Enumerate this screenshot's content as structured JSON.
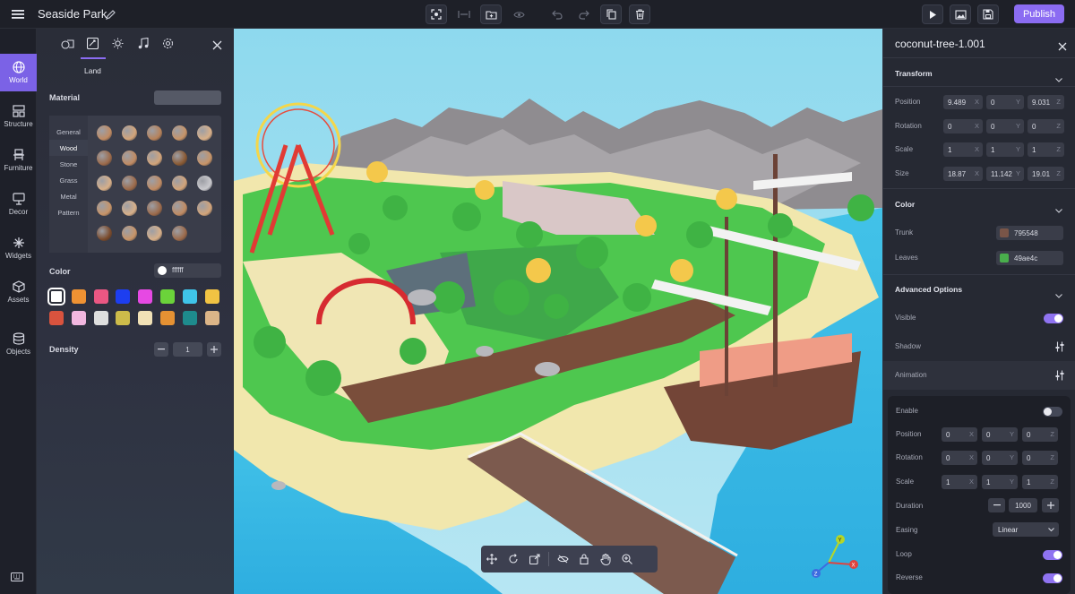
{
  "app": {
    "project_title": "Seaside Park",
    "publish_label": "Publish"
  },
  "toolbar": {
    "icons": [
      "menu-icon",
      "edit-icon",
      "focus-icon",
      "distribute-icon",
      "add-folder-icon",
      "eye-icon",
      "undo-icon",
      "redo-icon",
      "copy-icon",
      "delete-icon",
      "play-icon",
      "image-icon",
      "save-icon"
    ]
  },
  "leftnav": {
    "items": [
      {
        "label": "World",
        "icon": "globe-icon",
        "active": true
      },
      {
        "label": "Structure",
        "icon": "structure-icon"
      },
      {
        "label": "Furniture",
        "icon": "chair-icon"
      },
      {
        "label": "Decor",
        "icon": "decor-icon"
      },
      {
        "label": "Widgets",
        "icon": "widgets-icon"
      },
      {
        "label": "Assets",
        "icon": "cube-icon"
      },
      {
        "label": "Objects",
        "icon": "layers-icon"
      }
    ]
  },
  "leftpanel": {
    "active_tab": "Land",
    "material_label": "Material",
    "material_categories": [
      "General",
      "Wood",
      "Stone",
      "Grass",
      "Metal",
      "Pattern"
    ],
    "selected_category": "Wood",
    "color_label": "Color",
    "color_value": "ffffff",
    "density_label": "Density",
    "density_value": "1",
    "swatches": [
      "#ffffff",
      "#ef9233",
      "#ea5783",
      "#1d3ef0",
      "#e649e3",
      "#6bd33a",
      "#3fc4e9",
      "#f1c343",
      "#d9533e",
      "#f2b7e0",
      "#dedede",
      "#cdbb4a",
      "#f1e1b6",
      "#e59133",
      "#1e8b8d",
      "#dcb588"
    ]
  },
  "rightpanel": {
    "object_name": "coconut-tree-1.001",
    "transform_label": "Transform",
    "position_label": "Position",
    "position": [
      "9.489",
      "0",
      "9.031"
    ],
    "rotation_label": "Rotation",
    "rotation": [
      "0",
      "0",
      "0"
    ],
    "scale_label": "Scale",
    "scale": [
      "1",
      "1",
      "1"
    ],
    "size_label": "Size",
    "size": [
      "18.87",
      "11.142",
      "19.01"
    ],
    "color_label": "Color",
    "trunk_label": "Trunk",
    "trunk_hex": "795548",
    "trunk_color": "#795548",
    "leaves_label": "Leaves",
    "leaves_hex": "49ae4c",
    "leaves_color": "#49ae4c",
    "advanced_label": "Advanced Options",
    "visible_label": "Visible",
    "shadow_label": "Shadow",
    "animation_label": "Animation",
    "anim": {
      "enable_label": "Enable",
      "position_label": "Position",
      "position": [
        "0",
        "0",
        "0"
      ],
      "rotation_label": "Rotation",
      "rotation": [
        "0",
        "0",
        "0"
      ],
      "scale_label": "Scale",
      "scale": [
        "1",
        "1",
        "1"
      ],
      "duration_label": "Duration",
      "duration": "1000",
      "easing_label": "Easing",
      "easing": "Linear",
      "loop_label": "Loop",
      "reverse_label": "Reverse"
    },
    "axes": [
      "X",
      "Y",
      "Z"
    ]
  },
  "gizmo": {
    "x": "X",
    "y": "Y",
    "z": "Z"
  },
  "colors": {
    "accent": "#8b6cf2",
    "sea": "#3fc1e6",
    "sky": "#8fd6ea"
  }
}
